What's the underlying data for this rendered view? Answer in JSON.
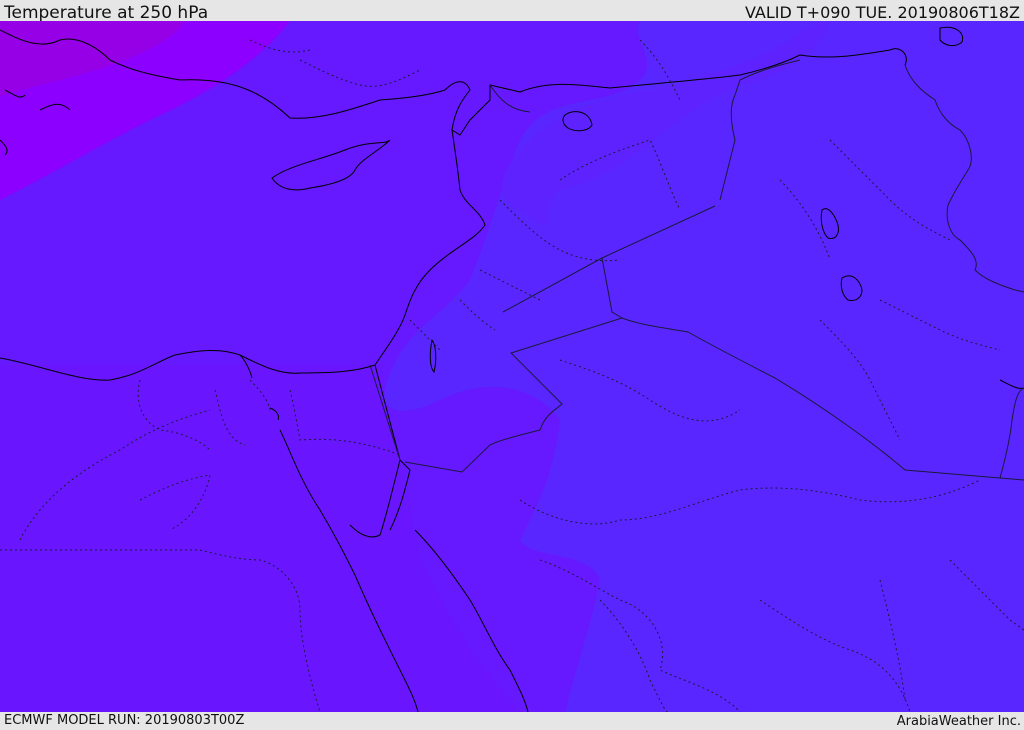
{
  "header": {
    "title": "Temperature at 250 hPa",
    "valid_time": "VALID T+090 TUE. 20190806T18Z"
  },
  "footer": {
    "model_run": "ECMWF MODEL RUN: 20190803T00Z",
    "credit": "ArabiaWeather Inc."
  },
  "map": {
    "field": "temperature",
    "level_hpa": 250,
    "colors": {
      "warm_band": "#8c00ff",
      "warm_core": "#9100e6",
      "main": "#6618ff",
      "main_alt": "#6a15ff",
      "cool": "#5a26ff",
      "cool_alt": "#5e22ff",
      "coastline": "#000000",
      "border": "#1a1a3a"
    }
  }
}
